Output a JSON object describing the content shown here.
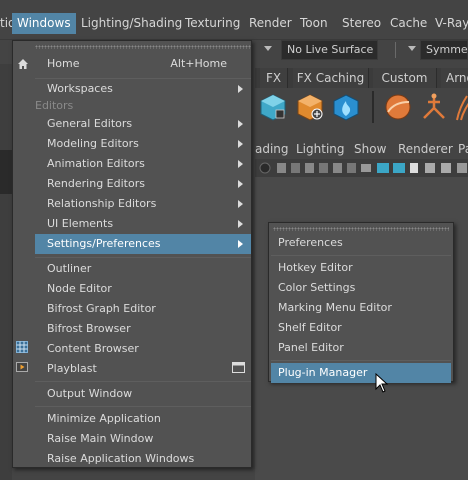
{
  "menubar": {
    "items": [
      "Windows",
      "Lighting/Shading",
      "Texturing",
      "Render",
      "Toon",
      "Stereo",
      "Cache",
      "V-Ray"
    ],
    "active": "Windows",
    "left_fragment": "tio"
  },
  "toolbar": {
    "live_surface": "No Live Surface",
    "symmetry": "Symmet"
  },
  "shelf": {
    "tabs": [
      "FX",
      "FX Caching",
      "Custom",
      "Arno"
    ]
  },
  "panel_menu": {
    "items": [
      "ading",
      "Lighting",
      "Show",
      "Renderer",
      "Pa"
    ]
  },
  "windows_menu": {
    "home": {
      "label": "Home",
      "shortcut": "Alt+Home"
    },
    "workspaces": "Workspaces",
    "editors_section": "Editors",
    "editors": [
      "General Editors",
      "Modeling Editors",
      "Animation Editors",
      "Rendering Editors",
      "Relationship Editors",
      "UI Elements",
      "Settings/Preferences"
    ],
    "tools": [
      "Outliner",
      "Node Editor",
      "Bifrost Graph Editor",
      "Bifrost Browser",
      "Content Browser",
      "Playblast"
    ],
    "output_window": "Output Window",
    "window_actions": [
      "Minimize Application",
      "Raise Main Window",
      "Raise Application Windows"
    ]
  },
  "submenu": {
    "preferences": "Preferences",
    "items": [
      "Hotkey Editor",
      "Color Settings",
      "Marking Menu Editor",
      "Shelf Editor",
      "Panel Editor"
    ],
    "plugin_manager": "Plug-in Manager"
  },
  "colors": {
    "highlight": "#5285a6",
    "menu_bg": "#525252",
    "app_bg": "#444444"
  }
}
